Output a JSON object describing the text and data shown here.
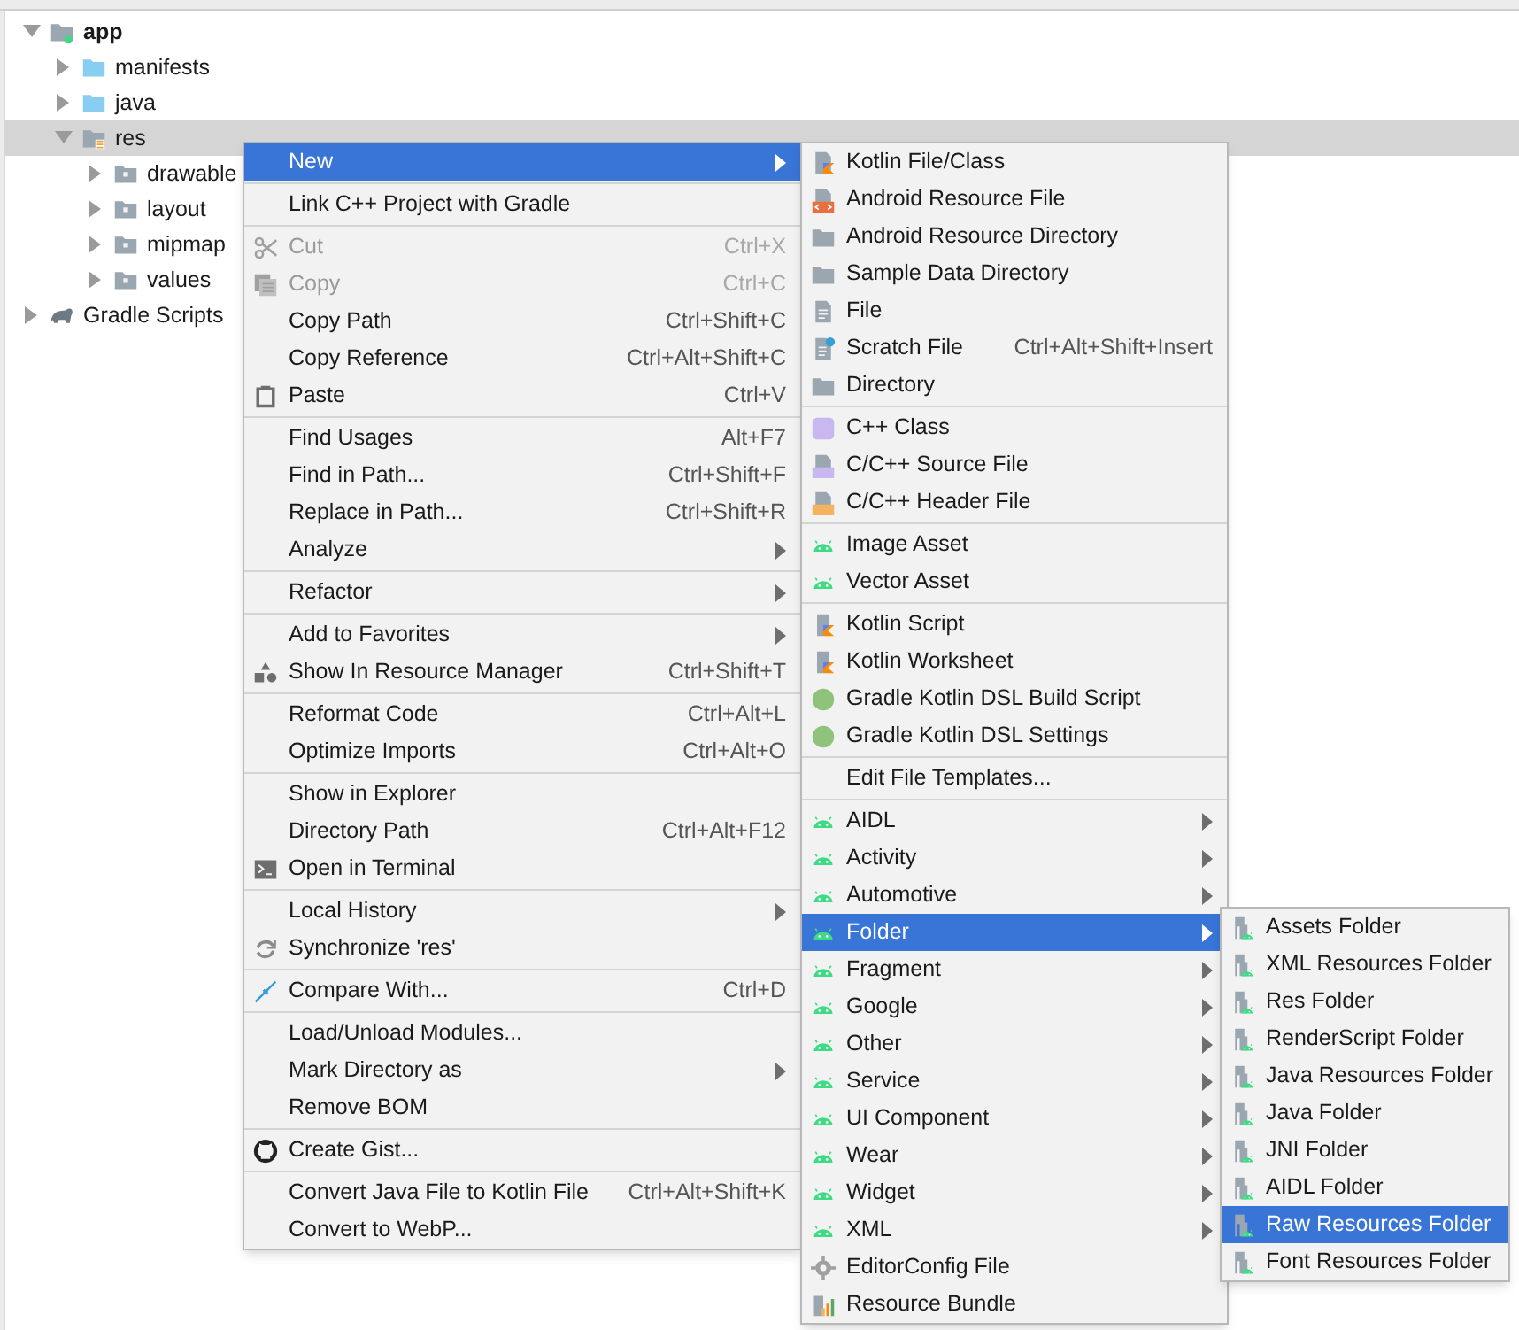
{
  "project_tree": [
    {
      "label": "app",
      "kind": "module",
      "expanded": true,
      "selected": false,
      "children": [
        {
          "label": "manifests",
          "kind": "folder",
          "expanded": false,
          "selected": false
        },
        {
          "label": "java",
          "kind": "folder",
          "expanded": false,
          "selected": false
        },
        {
          "label": "res",
          "kind": "res",
          "expanded": true,
          "selected": true,
          "children": [
            {
              "label": "drawable",
              "kind": "package",
              "expanded": false,
              "selected": false
            },
            {
              "label": "layout",
              "kind": "package",
              "expanded": false,
              "selected": false
            },
            {
              "label": "mipmap",
              "kind": "package",
              "expanded": false,
              "selected": false
            },
            {
              "label": "values",
              "kind": "package",
              "expanded": false,
              "selected": false
            }
          ]
        }
      ]
    },
    {
      "label": "Gradle Scripts",
      "kind": "gradle",
      "expanded": false,
      "selected": false
    }
  ],
  "context_menu": {
    "groups": [
      [
        {
          "label": "New",
          "kind": "plain",
          "submenu": true,
          "disabled": false,
          "selected": true
        }
      ],
      [
        {
          "label": "Link C++ Project with Gradle",
          "kind": "plain",
          "submenu": false,
          "disabled": false,
          "selected": false
        }
      ],
      [
        {
          "label": "Cut",
          "shortcut": "Ctrl+X",
          "kind": "cut",
          "submenu": false,
          "disabled": true,
          "selected": false
        },
        {
          "label": "Copy",
          "shortcut": "Ctrl+C",
          "kind": "copy",
          "submenu": false,
          "disabled": true,
          "selected": false
        },
        {
          "label": "Copy Path",
          "shortcut": "Ctrl+Shift+C",
          "kind": "plain",
          "submenu": false,
          "disabled": false,
          "selected": false
        },
        {
          "label": "Copy Reference",
          "shortcut": "Ctrl+Alt+Shift+C",
          "kind": "plain",
          "submenu": false,
          "disabled": false,
          "selected": false
        },
        {
          "label": "Paste",
          "shortcut": "Ctrl+V",
          "kind": "paste",
          "submenu": false,
          "disabled": false,
          "selected": false
        }
      ],
      [
        {
          "label": "Find Usages",
          "shortcut": "Alt+F7",
          "kind": "plain",
          "submenu": false,
          "disabled": false,
          "selected": false
        },
        {
          "label": "Find in Path...",
          "shortcut": "Ctrl+Shift+F",
          "kind": "plain",
          "submenu": false,
          "disabled": false,
          "selected": false
        },
        {
          "label": "Replace in Path...",
          "shortcut": "Ctrl+Shift+R",
          "kind": "plain",
          "submenu": false,
          "disabled": false,
          "selected": false
        },
        {
          "label": "Analyze",
          "kind": "plain",
          "submenu": true,
          "disabled": false,
          "selected": false
        }
      ],
      [
        {
          "label": "Refactor",
          "kind": "plain",
          "submenu": true,
          "disabled": false,
          "selected": false
        }
      ],
      [
        {
          "label": "Add to Favorites",
          "kind": "plain",
          "submenu": true,
          "disabled": false,
          "selected": false
        },
        {
          "label": "Show In Resource Manager",
          "shortcut": "Ctrl+Shift+T",
          "kind": "resource-manager",
          "submenu": false,
          "disabled": false,
          "selected": false
        }
      ],
      [
        {
          "label": "Reformat Code",
          "shortcut": "Ctrl+Alt+L",
          "kind": "plain",
          "submenu": false,
          "disabled": false,
          "selected": false
        },
        {
          "label": "Optimize Imports",
          "shortcut": "Ctrl+Alt+O",
          "kind": "plain",
          "submenu": false,
          "disabled": false,
          "selected": false
        }
      ],
      [
        {
          "label": "Show in Explorer",
          "kind": "plain",
          "submenu": false,
          "disabled": false,
          "selected": false
        },
        {
          "label": "Directory Path",
          "shortcut": "Ctrl+Alt+F12",
          "kind": "plain",
          "submenu": false,
          "disabled": false,
          "selected": false
        },
        {
          "label": "Open in Terminal",
          "kind": "terminal",
          "submenu": false,
          "disabled": false,
          "selected": false
        }
      ],
      [
        {
          "label": "Local History",
          "kind": "plain",
          "submenu": true,
          "disabled": false,
          "selected": false
        },
        {
          "label": "Synchronize 'res'",
          "kind": "sync",
          "submenu": false,
          "disabled": false,
          "selected": false
        }
      ],
      [
        {
          "label": "Compare With...",
          "shortcut": "Ctrl+D",
          "kind": "compare",
          "submenu": false,
          "disabled": false,
          "selected": false
        }
      ],
      [
        {
          "label": "Load/Unload Modules...",
          "kind": "plain",
          "submenu": false,
          "disabled": false,
          "selected": false
        },
        {
          "label": "Mark Directory as",
          "kind": "plain",
          "submenu": true,
          "disabled": false,
          "selected": false
        },
        {
          "label": "Remove BOM",
          "kind": "plain",
          "submenu": false,
          "disabled": false,
          "selected": false
        }
      ],
      [
        {
          "label": "Create Gist...",
          "kind": "github",
          "submenu": false,
          "disabled": false,
          "selected": false
        }
      ],
      [
        {
          "label": "Convert Java File to Kotlin File",
          "shortcut": "Ctrl+Alt+Shift+K",
          "kind": "plain",
          "submenu": false,
          "disabled": false,
          "selected": false
        },
        {
          "label": "Convert to WebP...",
          "kind": "plain",
          "submenu": false,
          "disabled": false,
          "selected": false
        }
      ]
    ]
  },
  "new_submenu": {
    "groups": [
      [
        {
          "label": "Kotlin File/Class",
          "kind": "kotlin",
          "submenu": false,
          "selected": false
        },
        {
          "label": "Android Resource File",
          "kind": "android-resource",
          "submenu": false,
          "selected": false
        },
        {
          "label": "Android Resource Directory",
          "kind": "folder",
          "submenu": false,
          "selected": false
        },
        {
          "label": "Sample Data Directory",
          "kind": "folder",
          "submenu": false,
          "selected": false
        },
        {
          "label": "File",
          "kind": "file",
          "submenu": false,
          "selected": false
        },
        {
          "label": "Scratch File",
          "shortcut": "Ctrl+Alt+Shift+Insert",
          "kind": "scratch",
          "submenu": false,
          "selected": false
        },
        {
          "label": "Directory",
          "kind": "folder",
          "submenu": false,
          "selected": false
        }
      ],
      [
        {
          "label": "C++ Class",
          "kind": "cpp-class",
          "submenu": false,
          "selected": false
        },
        {
          "label": "C/C++ Source File",
          "kind": "cpp-source",
          "submenu": false,
          "selected": false
        },
        {
          "label": "C/C++ Header File",
          "kind": "cpp-header",
          "submenu": false,
          "selected": false
        }
      ],
      [
        {
          "label": "Image Asset",
          "kind": "android",
          "submenu": false,
          "selected": false
        },
        {
          "label": "Vector Asset",
          "kind": "android",
          "submenu": false,
          "selected": false
        }
      ],
      [
        {
          "label": "Kotlin Script",
          "kind": "kotlin-script",
          "submenu": false,
          "selected": false
        },
        {
          "label": "Kotlin Worksheet",
          "kind": "kotlin-script",
          "submenu": false,
          "selected": false
        },
        {
          "label": "Gradle Kotlin DSL Build Script",
          "kind": "gradle-kts",
          "submenu": false,
          "selected": false
        },
        {
          "label": "Gradle Kotlin DSL Settings",
          "kind": "gradle-kts",
          "submenu": false,
          "selected": false
        }
      ],
      [
        {
          "label": "Edit File Templates...",
          "kind": "plain",
          "submenu": false,
          "selected": false
        }
      ],
      [
        {
          "label": "AIDL",
          "kind": "android",
          "submenu": true,
          "selected": false
        },
        {
          "label": "Activity",
          "kind": "android",
          "submenu": true,
          "selected": false
        },
        {
          "label": "Automotive",
          "kind": "android",
          "submenu": true,
          "selected": false
        },
        {
          "label": "Folder",
          "kind": "android",
          "submenu": true,
          "selected": true
        },
        {
          "label": "Fragment",
          "kind": "android",
          "submenu": true,
          "selected": false
        },
        {
          "label": "Google",
          "kind": "android",
          "submenu": true,
          "selected": false
        },
        {
          "label": "Other",
          "kind": "android",
          "submenu": true,
          "selected": false
        },
        {
          "label": "Service",
          "kind": "android",
          "submenu": true,
          "selected": false
        },
        {
          "label": "UI Component",
          "kind": "android",
          "submenu": true,
          "selected": false
        },
        {
          "label": "Wear",
          "kind": "android",
          "submenu": true,
          "selected": false
        },
        {
          "label": "Widget",
          "kind": "android",
          "submenu": true,
          "selected": false
        },
        {
          "label": "XML",
          "kind": "android",
          "submenu": true,
          "selected": false
        },
        {
          "label": "EditorConfig File",
          "kind": "gear",
          "submenu": false,
          "selected": false
        },
        {
          "label": "Resource Bundle",
          "kind": "bundle",
          "submenu": false,
          "selected": false
        }
      ]
    ]
  },
  "folder_submenu": {
    "groups": [
      [
        {
          "label": "Assets Folder",
          "kind": "android-folder",
          "submenu": false,
          "selected": false
        },
        {
          "label": "XML Resources Folder",
          "kind": "android-folder",
          "submenu": false,
          "selected": false
        },
        {
          "label": "Res Folder",
          "kind": "android-folder",
          "submenu": false,
          "selected": false
        },
        {
          "label": "RenderScript Folder",
          "kind": "android-folder",
          "submenu": false,
          "selected": false
        },
        {
          "label": "Java Resources Folder",
          "kind": "android-folder",
          "submenu": false,
          "selected": false
        },
        {
          "label": "Java Folder",
          "kind": "android-folder",
          "submenu": false,
          "selected": false
        },
        {
          "label": "JNI Folder",
          "kind": "android-folder",
          "submenu": false,
          "selected": false
        },
        {
          "label": "AIDL Folder",
          "kind": "android-folder",
          "submenu": false,
          "selected": false
        },
        {
          "label": "Raw Resources Folder",
          "kind": "android-folder",
          "submenu": false,
          "selected": true
        },
        {
          "label": "Font Resources Folder",
          "kind": "android-folder",
          "submenu": false,
          "selected": false
        }
      ]
    ]
  }
}
